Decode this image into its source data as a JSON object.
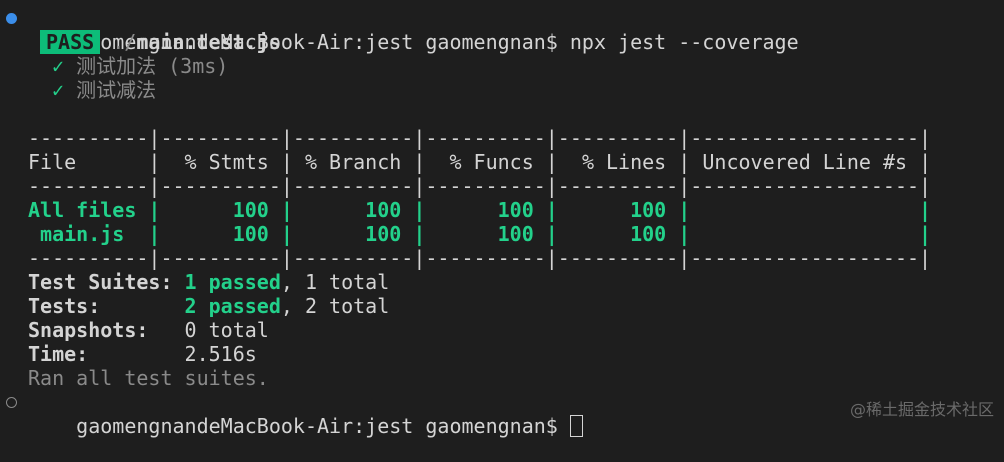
{
  "colors": {
    "background": "#1e1e1e",
    "text": "#d4d4d4",
    "pass_green": "#23d18b",
    "badge_green": "#0dbc79",
    "dim": "#8a8a8a",
    "prompt_dot": "#3b8eea"
  },
  "command_line": {
    "prompt": "gaomengnandeMacBook-Air:jest gaomengnan$",
    "command": "npx jest --coverage"
  },
  "result": {
    "badge": "PASS",
    "file_dir": "./",
    "file_name": "main.test.js",
    "tests": [
      {
        "check": "✓",
        "name": "测试加法",
        "time": "(3ms)"
      },
      {
        "check": "✓",
        "name": "测试减法",
        "time": ""
      }
    ]
  },
  "coverage_table": {
    "sep_top": "----------|----------|----------|----------|----------|-------------------|",
    "header": {
      "file": "File",
      "stmts": "% Stmts",
      "branch": "% Branch",
      "funcs": "% Funcs",
      "lines": "% Lines",
      "uncovered": "Uncovered Line #s"
    },
    "sep_mid": "----------|----------|----------|----------|----------|-------------------|",
    "rows": [
      {
        "file": "All files",
        "stmts": "100",
        "branch": "100",
        "funcs": "100",
        "lines": "100",
        "uncovered": ""
      },
      {
        "file": " main.js",
        "stmts": "100",
        "branch": "100",
        "funcs": "100",
        "lines": "100",
        "uncovered": ""
      }
    ],
    "sep_bottom": "----------|----------|----------|----------|----------|-------------------|"
  },
  "summary": {
    "suites_label": "Test Suites:",
    "suites_passed": "1 passed",
    "suites_total": ", 1 total",
    "tests_label": "Tests:",
    "tests_passed": "2 passed",
    "tests_total": ", 2 total",
    "snapshots_label": "Snapshots:",
    "snapshots_value": "0 total",
    "time_label": "Time:",
    "time_value": "2.516s",
    "ran_text": "Ran all test suites."
  },
  "next_prompt": "gaomengnandeMacBook-Air:jest gaomengnan$",
  "watermark": "@稀土掘金技术社区"
}
